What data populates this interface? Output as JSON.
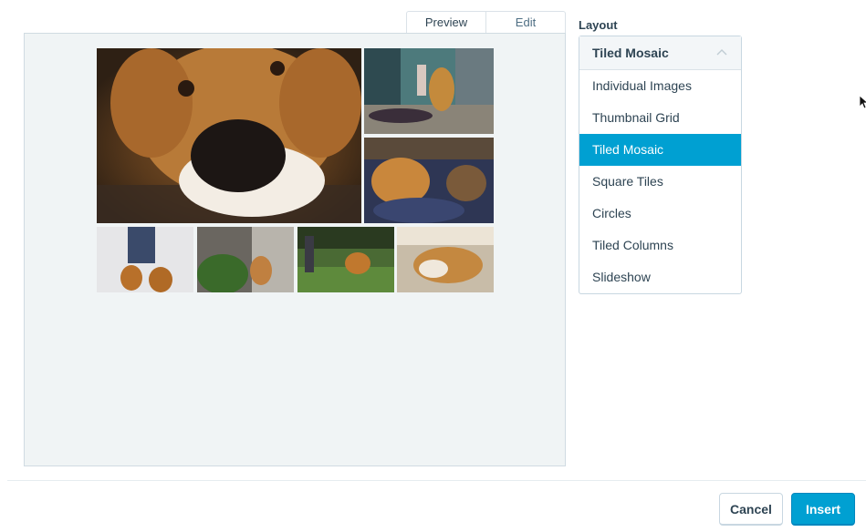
{
  "tabs": [
    {
      "label": "Preview",
      "active": true
    },
    {
      "label": "Edit",
      "active": false
    }
  ],
  "layout": {
    "label": "Layout",
    "selected": "Tiled Mosaic",
    "options": [
      "Individual Images",
      "Thumbnail Grid",
      "Tiled Mosaic",
      "Square Tiles",
      "Circles",
      "Tiled Columns",
      "Slideshow"
    ]
  },
  "buttons": {
    "cancel": "Cancel",
    "insert": "Insert"
  },
  "colors": {
    "accent": "#00a0d2",
    "preview_bg": "#f0f4f5",
    "text": "#2e4453"
  }
}
